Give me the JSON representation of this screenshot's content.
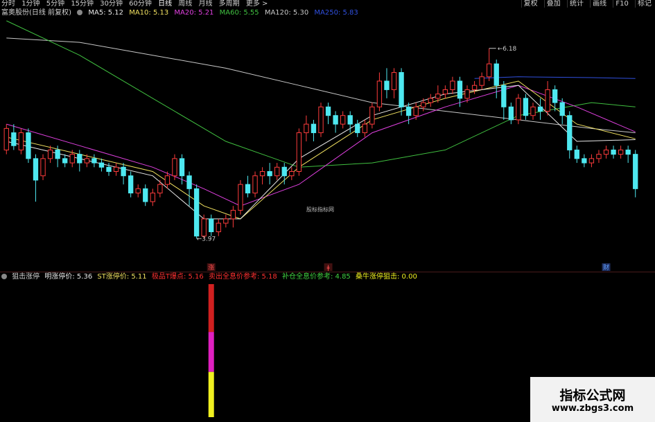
{
  "topbar": {
    "periods": [
      "分时",
      "1分钟",
      "5分钟",
      "15分钟",
      "30分钟",
      "60分钟",
      "日线",
      "周线",
      "月线",
      "多周期",
      "更多 >"
    ],
    "active_period": "日线",
    "tools": [
      "复权",
      "叠加",
      "统计",
      "画线",
      "F10",
      "标记"
    ]
  },
  "price_legend": {
    "title": "富奥股份(日线 前复权)",
    "ma5": "MA5: 5.12",
    "ma10": "MA10: 5.13",
    "ma20": "MA20: 5.21",
    "ma60": "MA60: 5.55",
    "ma120": "MA120: 5.30",
    "ma250": "MA250: 5.83"
  },
  "colors": {
    "up": "#ff3c3c",
    "down": "#4ee8f0",
    "ma5": "#e8e8e8",
    "ma10": "#f0e060",
    "ma20": "#e040e0",
    "ma60": "#40c040",
    "ma120": "#c8c8c8",
    "ma250": "#3050e0"
  },
  "chart_data": {
    "type": "candlestick",
    "price_range": [
      3.7,
      6.5
    ],
    "annotations": {
      "high": "6.18",
      "low": "3.97"
    },
    "event_markers": [
      "涨",
      "ǂ",
      "财"
    ],
    "candles": [
      [
        5.0,
        5.25,
        4.95,
        5.3
      ],
      [
        5.2,
        5.05,
        5.0,
        5.3
      ],
      [
        5.0,
        5.2,
        4.95,
        5.25
      ],
      [
        5.2,
        4.9,
        4.85,
        5.25
      ],
      [
        4.9,
        4.65,
        4.4,
        4.95
      ],
      [
        4.7,
        4.9,
        4.65,
        4.95
      ],
      [
        4.9,
        5.0,
        4.85,
        5.05
      ],
      [
        5.0,
        4.9,
        4.8,
        5.05
      ],
      [
        4.9,
        4.85,
        4.8,
        4.95
      ],
      [
        4.85,
        4.95,
        4.8,
        5.0
      ],
      [
        4.95,
        4.85,
        4.75,
        5.0
      ],
      [
        4.85,
        4.9,
        4.8,
        4.95
      ],
      [
        4.9,
        4.85,
        4.8,
        4.95
      ],
      [
        4.85,
        4.8,
        4.75,
        4.9
      ],
      [
        4.8,
        4.75,
        4.7,
        4.85
      ],
      [
        4.75,
        4.8,
        4.7,
        4.85
      ],
      [
        4.8,
        4.7,
        4.6,
        4.85
      ],
      [
        4.7,
        4.5,
        4.45,
        4.75
      ],
      [
        4.5,
        4.55,
        4.45,
        4.6
      ],
      [
        4.55,
        4.4,
        4.35,
        4.6
      ],
      [
        4.4,
        4.5,
        4.35,
        4.55
      ],
      [
        4.5,
        4.6,
        4.45,
        4.65
      ],
      [
        4.6,
        4.7,
        4.55,
        4.75
      ],
      [
        4.7,
        4.9,
        4.65,
        4.95
      ],
      [
        4.9,
        4.7,
        4.6,
        4.95
      ],
      [
        4.7,
        4.55,
        4.35,
        4.75
      ],
      [
        4.55,
        4.0,
        3.97,
        4.6
      ],
      [
        4.0,
        4.2,
        3.97,
        4.25
      ],
      [
        4.2,
        4.05,
        4.0,
        4.25
      ],
      [
        4.05,
        4.15,
        4.0,
        4.2
      ],
      [
        4.15,
        4.2,
        4.1,
        4.25
      ],
      [
        4.2,
        4.3,
        4.1,
        4.35
      ],
      [
        4.3,
        4.6,
        4.25,
        4.65
      ],
      [
        4.6,
        4.5,
        4.45,
        4.7
      ],
      [
        4.5,
        4.7,
        4.45,
        4.75
      ],
      [
        4.7,
        4.75,
        4.6,
        4.8
      ],
      [
        4.75,
        4.7,
        4.6,
        4.85
      ],
      [
        4.7,
        4.8,
        4.65,
        4.85
      ],
      [
        4.8,
        4.7,
        4.6,
        4.85
      ],
      [
        4.7,
        4.75,
        4.65,
        4.8
      ],
      [
        4.75,
        5.2,
        4.7,
        5.25
      ],
      [
        5.2,
        5.3,
        5.1,
        5.4
      ],
      [
        5.3,
        5.2,
        5.1,
        5.35
      ],
      [
        5.2,
        5.5,
        5.15,
        5.55
      ],
      [
        5.5,
        5.4,
        5.3,
        5.55
      ],
      [
        5.4,
        5.3,
        5.2,
        5.45
      ],
      [
        5.3,
        5.4,
        5.25,
        5.45
      ],
      [
        5.4,
        5.3,
        5.2,
        5.45
      ],
      [
        5.3,
        5.2,
        5.15,
        5.35
      ],
      [
        5.2,
        5.3,
        5.15,
        5.35
      ],
      [
        5.3,
        5.5,
        5.25,
        5.55
      ],
      [
        5.5,
        5.8,
        5.45,
        5.9
      ],
      [
        5.8,
        5.7,
        5.6,
        5.95
      ],
      [
        5.7,
        5.9,
        5.6,
        5.95
      ],
      [
        5.9,
        5.5,
        5.4,
        5.95
      ],
      [
        5.5,
        5.4,
        5.3,
        5.55
      ],
      [
        5.4,
        5.5,
        5.35,
        5.55
      ],
      [
        5.5,
        5.55,
        5.45,
        5.6
      ],
      [
        5.55,
        5.6,
        5.5,
        5.65
      ],
      [
        5.6,
        5.65,
        5.55,
        5.75
      ],
      [
        5.65,
        5.7,
        5.6,
        5.75
      ],
      [
        5.7,
        5.8,
        5.65,
        5.85
      ],
      [
        5.8,
        5.6,
        5.5,
        5.85
      ],
      [
        5.6,
        5.7,
        5.55,
        5.75
      ],
      [
        5.7,
        5.75,
        5.65,
        5.8
      ],
      [
        5.75,
        5.85,
        5.7,
        5.9
      ],
      [
        5.85,
        6.0,
        5.8,
        6.18
      ],
      [
        6.0,
        5.75,
        5.6,
        6.05
      ],
      [
        5.75,
        5.5,
        5.35,
        5.8
      ],
      [
        5.5,
        5.35,
        5.3,
        5.55
      ],
      [
        5.35,
        5.6,
        5.3,
        5.65
      ],
      [
        5.6,
        5.4,
        5.35,
        5.65
      ],
      [
        5.4,
        5.5,
        5.35,
        5.55
      ],
      [
        5.5,
        5.45,
        5.35,
        5.6
      ],
      [
        5.45,
        5.7,
        5.4,
        5.8
      ],
      [
        5.7,
        5.55,
        5.45,
        5.75
      ],
      [
        5.55,
        5.4,
        5.3,
        5.6
      ],
      [
        5.4,
        5.0,
        4.9,
        5.45
      ],
      [
        5.0,
        4.9,
        4.85,
        5.05
      ],
      [
        4.9,
        4.85,
        4.8,
        4.95
      ],
      [
        4.85,
        4.9,
        4.8,
        4.95
      ],
      [
        4.9,
        4.95,
        4.85,
        5.0
      ],
      [
        4.95,
        5.0,
        4.9,
        5.05
      ],
      [
        5.0,
        4.95,
        4.9,
        5.05
      ],
      [
        4.95,
        5.0,
        4.9,
        5.05
      ],
      [
        5.0,
        4.95,
        4.85,
        5.05
      ],
      [
        4.95,
        4.55,
        4.45,
        5.0
      ]
    ],
    "ma_lines": {
      "ma120": [
        [
          0,
          6.3
        ],
        [
          10,
          6.25
        ],
        [
          20,
          6.1
        ],
        [
          30,
          5.95
        ],
        [
          40,
          5.75
        ],
        [
          50,
          5.55
        ],
        [
          60,
          5.45
        ],
        [
          70,
          5.35
        ],
        [
          80,
          5.25
        ],
        [
          86,
          5.2
        ]
      ],
      "ma60": [
        [
          0,
          6.5
        ],
        [
          10,
          6.1
        ],
        [
          20,
          5.6
        ],
        [
          30,
          5.1
        ],
        [
          40,
          4.8
        ],
        [
          50,
          4.85
        ],
        [
          60,
          5.0
        ],
        [
          70,
          5.4
        ],
        [
          80,
          5.55
        ],
        [
          86,
          5.5
        ]
      ],
      "ma250": [
        [
          64,
          5.83
        ],
        [
          70,
          5.85
        ],
        [
          80,
          5.84
        ],
        [
          86,
          5.83
        ]
      ],
      "ma20": [
        [
          0,
          5.3
        ],
        [
          10,
          5.05
        ],
        [
          20,
          4.8
        ],
        [
          27,
          4.55
        ],
        [
          32,
          4.35
        ],
        [
          40,
          4.6
        ],
        [
          50,
          5.2
        ],
        [
          60,
          5.5
        ],
        [
          70,
          5.75
        ],
        [
          78,
          5.5
        ],
        [
          86,
          5.21
        ]
      ],
      "ma10": [
        [
          0,
          5.15
        ],
        [
          10,
          4.95
        ],
        [
          20,
          4.75
        ],
        [
          27,
          4.35
        ],
        [
          32,
          4.2
        ],
        [
          40,
          4.8
        ],
        [
          50,
          5.35
        ],
        [
          60,
          5.6
        ],
        [
          70,
          5.8
        ],
        [
          78,
          5.3
        ],
        [
          86,
          5.13
        ]
      ],
      "ma5": [
        [
          0,
          5.1
        ],
        [
          10,
          4.9
        ],
        [
          20,
          4.7
        ],
        [
          27,
          4.2
        ],
        [
          32,
          4.2
        ],
        [
          40,
          4.9
        ],
        [
          50,
          5.4
        ],
        [
          60,
          5.65
        ],
        [
          70,
          5.75
        ],
        [
          78,
          5.1
        ],
        [
          86,
          5.12
        ]
      ]
    },
    "signal_bar": {
      "index": 28,
      "segments": [
        {
          "color": "#d02020",
          "from": 0.0,
          "to": 0.36
        },
        {
          "color": "#e020c0",
          "from": 0.36,
          "to": 0.66
        },
        {
          "color": "#f0f020",
          "from": 0.66,
          "to": 1.0
        }
      ]
    }
  },
  "indicator_legend": {
    "title": "狙击涨停",
    "v1": "明涨停价: 5.36",
    "v2": "ST涨停价: 5.11",
    "v3": "极品T爆点: 5.16",
    "v4": "卖出全息价参考: 5.18",
    "v5": "补仓全息价参考: 4.85",
    "v6": "桑牛涨停狙击: 0.00"
  },
  "center_mark": "股标指标网",
  "watermark": {
    "title": "指标公式网",
    "url": "www.zbgs3.com"
  }
}
